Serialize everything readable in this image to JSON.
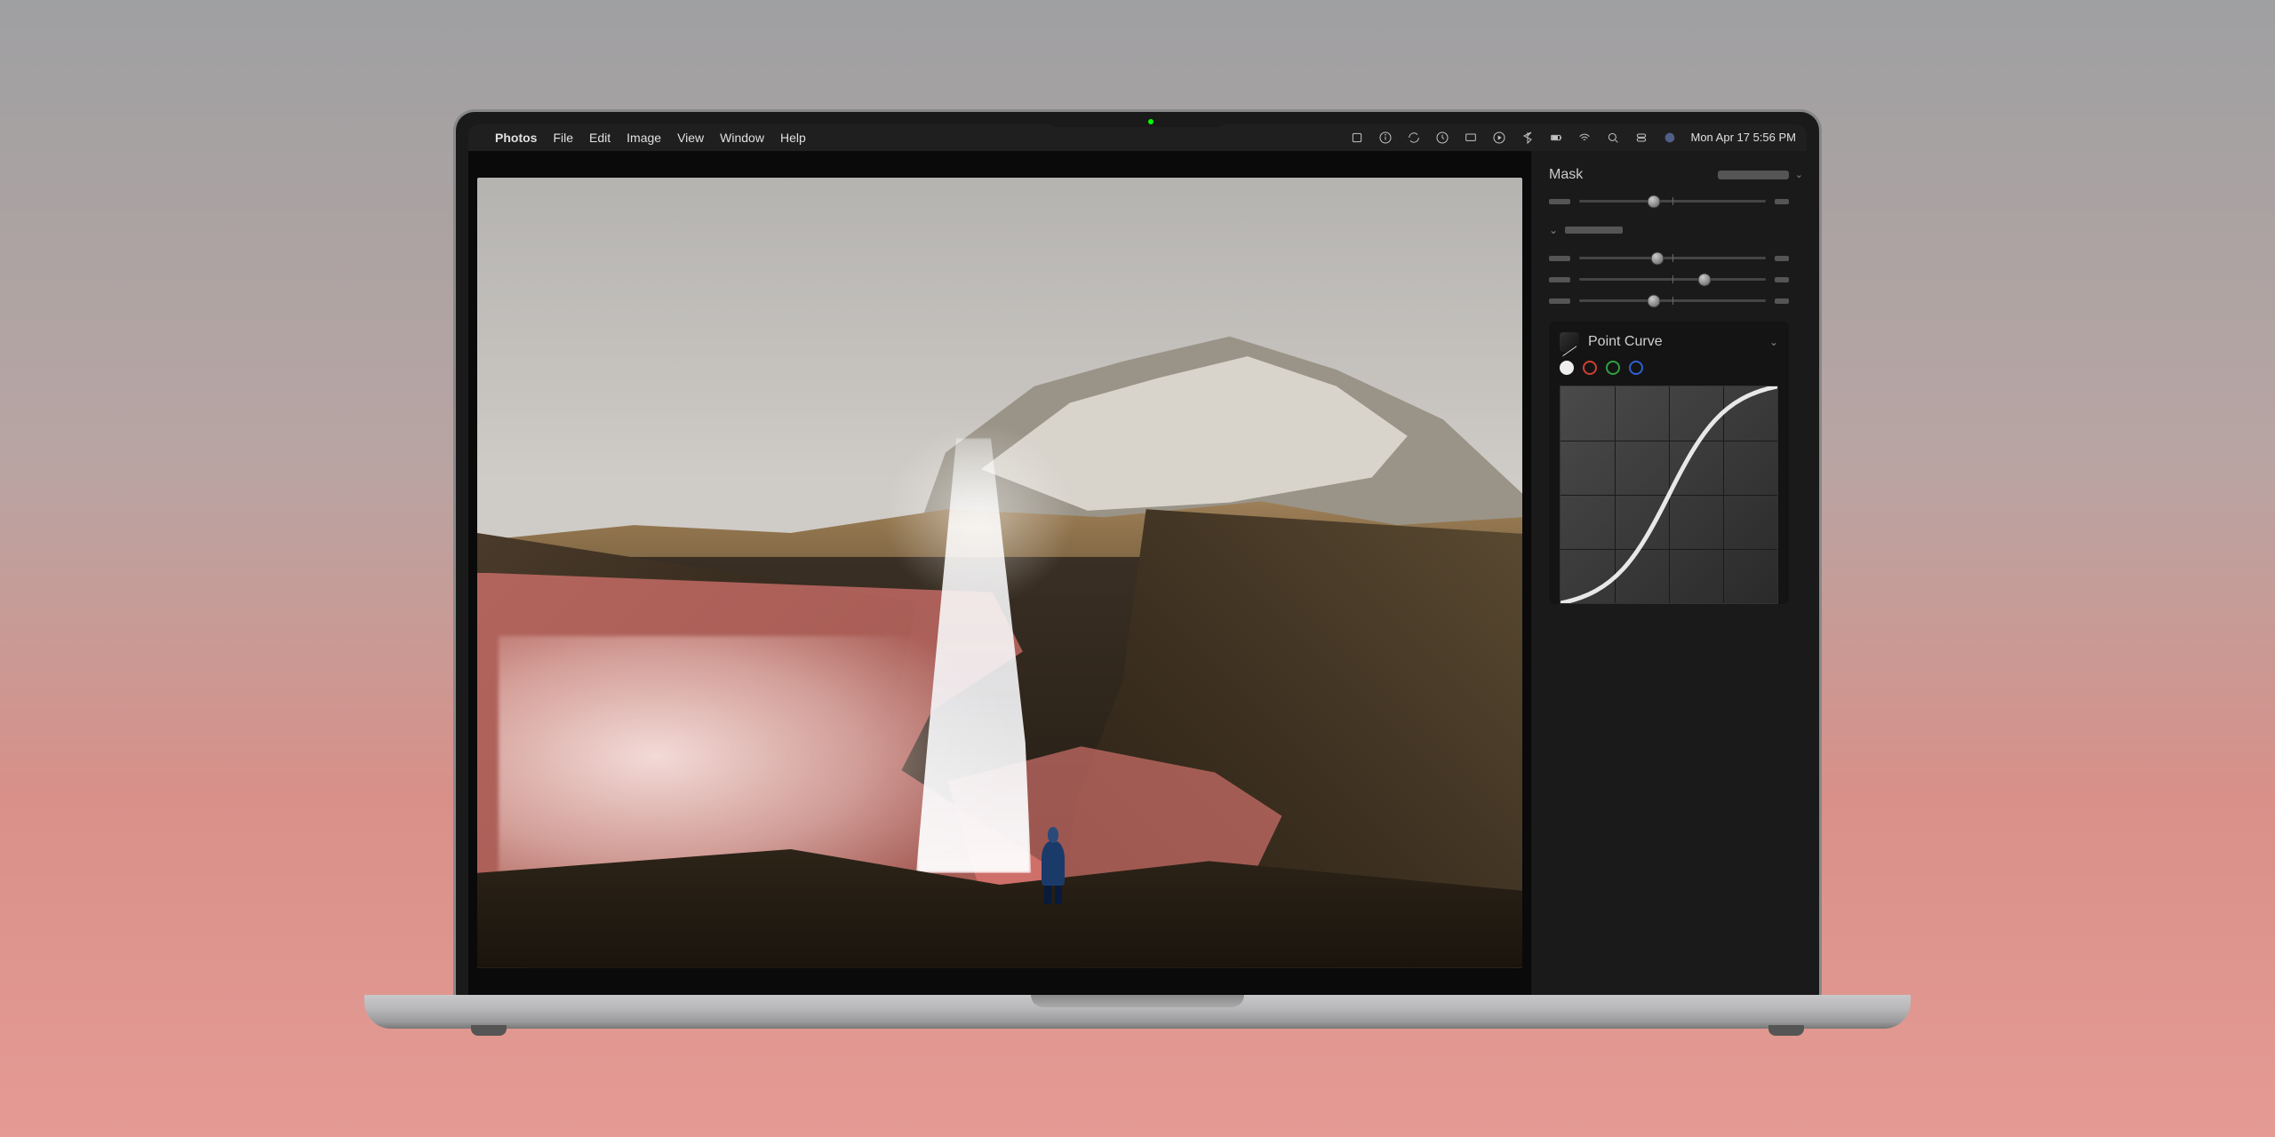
{
  "menubar": {
    "app_name": "Photos",
    "items": [
      "File",
      "Edit",
      "Image",
      "View",
      "Window",
      "Help"
    ],
    "datetime": "Mon Apr 17  5:56 PM"
  },
  "sidebar": {
    "mask_label": "Mask",
    "sliders": [
      {
        "pos": 40
      },
      {
        "pos": 42
      },
      {
        "pos": 67
      },
      {
        "pos": 40
      }
    ],
    "curve": {
      "title": "Point Curve",
      "channels": [
        "luminance",
        "red",
        "green",
        "blue"
      ],
      "active": "luminance"
    }
  }
}
